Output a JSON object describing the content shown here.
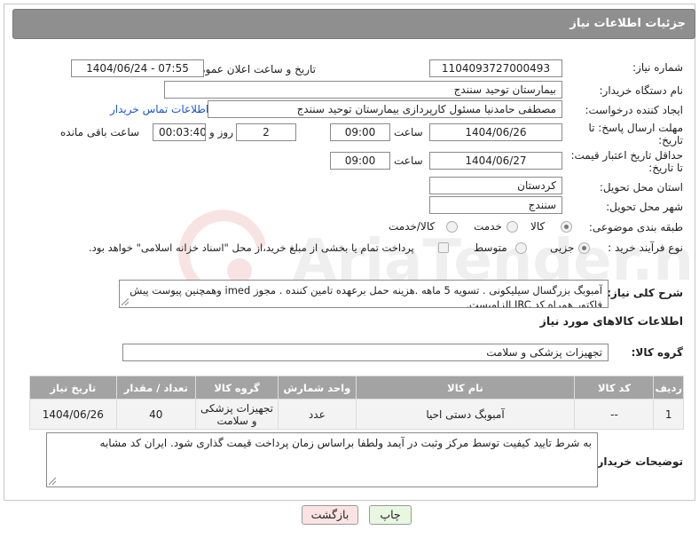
{
  "header": {
    "title": "جزئیات اطلاعات نیاز"
  },
  "form": {
    "need_number": {
      "label": "شماره نیاز:",
      "value": "1104093727000493"
    },
    "announce_datetime": {
      "label": "تاریخ و ساعت اعلان عمومی:",
      "value": "1404/06/24 - 07:55"
    },
    "buyer_org": {
      "label": "نام دستگاه خریدار:",
      "value": "بیمارستان توحید سنندج"
    },
    "creator": {
      "label": "ایجاد کننده درخواست:",
      "value": "مصطفی حامدنیا مسئول کارپردازی بیمارستان توحید سنندج",
      "contact_link": "اطلاعات تماس خریدار"
    },
    "reply_deadline": {
      "label1": "مهلت ارسال پاسخ: تا",
      "label2": "تاریخ:",
      "date": "1404/06/26",
      "time_label": "ساعت",
      "time": "09:00",
      "days": "2",
      "days_label": "روز و",
      "remaining": "00:03:40",
      "remaining_label": "ساعت باقی مانده"
    },
    "price_validity": {
      "label1": "حداقل تاریخ اعتبار قیمت:",
      "label2": "تا تاریخ:",
      "date": "1404/06/27",
      "time_label": "ساعت",
      "time": "09:00"
    },
    "province": {
      "label": "استان محل تحویل:",
      "value": "کردستان"
    },
    "city": {
      "label": "شهر محل تحویل:",
      "value": "سنندج"
    },
    "category": {
      "label": "طبقه بندی موضوعی:",
      "options": [
        "کالا",
        "خدمت",
        "کالا/خدمت"
      ],
      "selected": "کالا"
    },
    "process": {
      "label": "نوع فرآیند خرید :",
      "options": [
        "جزیی",
        "متوسط"
      ],
      "selected": "جزیی",
      "payment_note": "پرداخت تمام یا بخشی از مبلغ خرید،از محل \"اسناد خزانه اسلامی\" خواهد بود."
    }
  },
  "description": {
    "label": "شرح کلی نیاز:",
    "text": "آمبوبگ بزرگسال سیلیکونی . تسویه 5 ماهه .هزینه حمل برعهده تامین کننده . مجوز imed وهمچنین پیوست پیش فاکتور همراه کد IRC  الزامیست."
  },
  "goods_section": {
    "title": "اطلاعات کالاهای مورد نیاز",
    "group_label": "گروه کالا:",
    "group_value": "تجهیزات پزشکی و سلامت"
  },
  "table": {
    "headers": [
      "ردیف",
      "کد کالا",
      "نام کالا",
      "واحد شمارش",
      "گروه کالا",
      "تعداد / مقدار",
      "تاریخ نیاز"
    ],
    "rows": [
      [
        "1",
        "--",
        "آمبوبگ دستی احیا",
        "عدد",
        "تجهیزات پزشکی و سلامت",
        "40",
        "1404/06/26"
      ]
    ]
  },
  "buyer_notes": {
    "label": "توضیحات خریدار:",
    "text": "به شرط تایید کیفیت توسط مرکز وثبت در آیمد ولطفا براساس زمان پرداخت قیمت گذاری شود. ایران کد مشابه"
  },
  "buttons": {
    "print": "چاپ",
    "back": "بازگشت"
  },
  "watermark": {
    "text": "AriaTender.net"
  },
  "colors": {
    "header_bg": "#8f8f8f",
    "link": "#1a55c8",
    "print_btn": "#e8f7e0",
    "back_btn": "#fbe3e3"
  }
}
